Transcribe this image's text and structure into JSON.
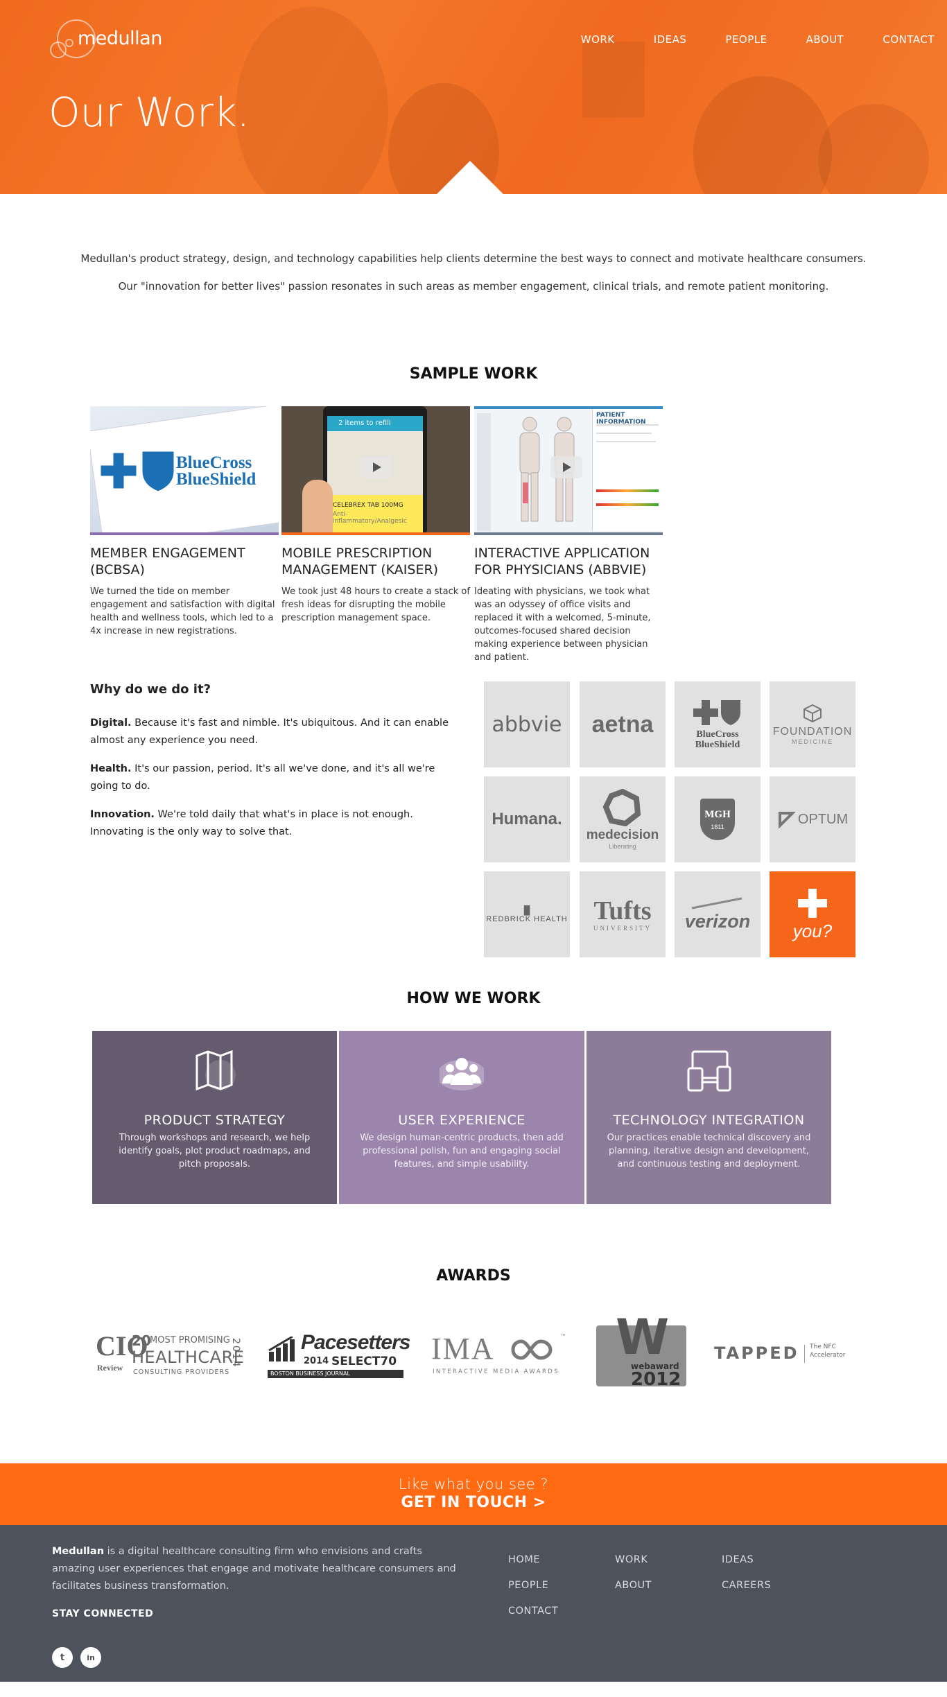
{
  "brand": {
    "logo_text": "medullan",
    "accent": "#f5661a"
  },
  "nav": [
    "WORK",
    "IDEAS",
    "PEOPLE",
    "ABOUT",
    "CONTACT"
  ],
  "hero": {
    "title": "Our Work."
  },
  "intro": {
    "line1": "Medullan's product strategy, design, and technology capabilities help clients determine the best ways to connect and motivate healthcare consumers.",
    "line2": "Our \"innovation for better lives\" passion resonates in such areas as member engagement, clinical trials, and remote patient monitoring."
  },
  "sample_work": {
    "heading": "SAMPLE WORK",
    "items": [
      {
        "title": "MEMBER ENGAGEMENT (BCBSA)",
        "desc": "We turned the tide on member engagement and satisfaction with digital health and wellness tools, which led to a 4x increase in new registrations.",
        "thumb_logo": "BlueCross BlueShield",
        "accent": "#8a6db0"
      },
      {
        "title": "MOBILE PRESCRIPTION MANAGEMENT (KAISER)",
        "desc": "We took just 48 hours to create a stack of fresh ideas for disrupting the mobile prescription management space.",
        "thumb_text_top": "2 items to refill",
        "thumb_text_card": "CELEBREX TAB 100MG",
        "thumb_text_sub": "Anti-inflammatory/Analgesic",
        "accent": "#f5661a"
      },
      {
        "title": "INTERACTIVE APPLICATION FOR PHYSICIANS (ABBVIE)",
        "desc": "Ideating with physicians, we took what was an odyssey of office visits and replaced it with a welcomed, 5-minute, outcomes-focused shared decision making experience between physician and patient.",
        "thumb_text": "PATIENT INFORMATION",
        "accent": "#6b7a8c"
      }
    ]
  },
  "why": {
    "heading": "Why do we do it?",
    "points": [
      {
        "label": "Digital.",
        "text": " Because it's fast and nimble. It's ubiquitous. And it can enable almost any experience you need."
      },
      {
        "label": "Health.",
        "text": " It's our passion, period. It's all we've done, and it's all we're going to do."
      },
      {
        "label": "Innovation.",
        "text": " We're told daily that what's in place is not enough. Innovating is the only way to solve that."
      }
    ]
  },
  "clients": [
    {
      "name": "abbvie",
      "icon": "abbvie-logo"
    },
    {
      "name": "aetna",
      "icon": "aetna-logo"
    },
    {
      "name": "BlueCross BlueShield",
      "icon": "bcbs-logo"
    },
    {
      "name": "FOUNDATION",
      "sub": "MEDICINE",
      "icon": "foundation-medicine-logo"
    },
    {
      "name": "Humana.",
      "icon": "humana-logo"
    },
    {
      "name": "medecision",
      "sub": "Liberating",
      "icon": "medecision-logo"
    },
    {
      "name": "MGH",
      "sub": "1811",
      "icon": "mgh-logo"
    },
    {
      "name": "OPTUM",
      "icon": "optum-logo"
    },
    {
      "name": "REDBRICK HEALTH",
      "icon": "redbrick-logo"
    },
    {
      "name": "Tufts",
      "sub": "UNIVERSITY",
      "icon": "tufts-logo"
    },
    {
      "name": "verizon",
      "icon": "verizon-logo"
    },
    {
      "name": "you?",
      "icon": "plus-icon"
    }
  ],
  "how_we_work": {
    "heading": "HOW WE WORK",
    "items": [
      {
        "title": "PRODUCT STRATEGY",
        "desc": "Through workshops and research, we help identify goals, plot product roadmaps, and pitch proposals.",
        "icon": "map-icon",
        "color": "#645b6e"
      },
      {
        "title": "USER EXPERIENCE",
        "desc": "We design human-centric products, then add professional polish, fun and engaging social features, and simple usability.",
        "icon": "users-icon",
        "color": "#9c85ad"
      },
      {
        "title": "TECHNOLOGY INTEGRATION",
        "desc": "Our practices enable technical discovery and planning, iterative design and development, and continuous testing and deployment.",
        "icon": "devices-icon",
        "color": "#8d7c99"
      }
    ]
  },
  "awards": {
    "heading": "AWARDS",
    "items": [
      {
        "name": "CIO Review 20 Most Promising Healthcare Consulting Providers 2014",
        "l1": "CIO",
        "l2": "Review",
        "l3": "20",
        "l4": "MOST PROMISING",
        "l5": "HEALTHCARE",
        "l6": "CONSULTING PROVIDERS",
        "l7": "2014"
      },
      {
        "name": "Pacesetters 2014 Select70",
        "l1": "Pacesetters",
        "l2": "2014",
        "l3": "SELECT70",
        "l4": "BOSTON BUSINESS JOURNAL"
      },
      {
        "name": "IMA Interactive Media Awards",
        "l1": "IMA",
        "l2": "INTERACTIVE MEDIA AWARDS",
        "l3": "™"
      },
      {
        "name": "webaward 2012",
        "l1": "W",
        "l2": "webaward",
        "l3": "2012"
      },
      {
        "name": "TAPPED The NFC Accelerator",
        "l1": "TAPPED",
        "l2": "The NFC",
        "l3": "Accelerator"
      }
    ]
  },
  "cta": {
    "line1": "Like what you see ?",
    "line2": "GET IN TOUCH >"
  },
  "footer": {
    "brand": "Medullan",
    "about": " is a digital healthcare consulting firm who envisions and crafts amazing user experiences that engage and motivate healthcare consumers and facilitates business transformation.",
    "stay": "STAY CONNECTED",
    "social": [
      {
        "label": "t",
        "icon": "twitter-icon"
      },
      {
        "label": "in",
        "icon": "linkedin-icon"
      }
    ],
    "links": [
      "HOME",
      "WORK",
      "IDEAS",
      "PEOPLE",
      "ABOUT",
      "CAREERS",
      "CONTACT"
    ]
  }
}
